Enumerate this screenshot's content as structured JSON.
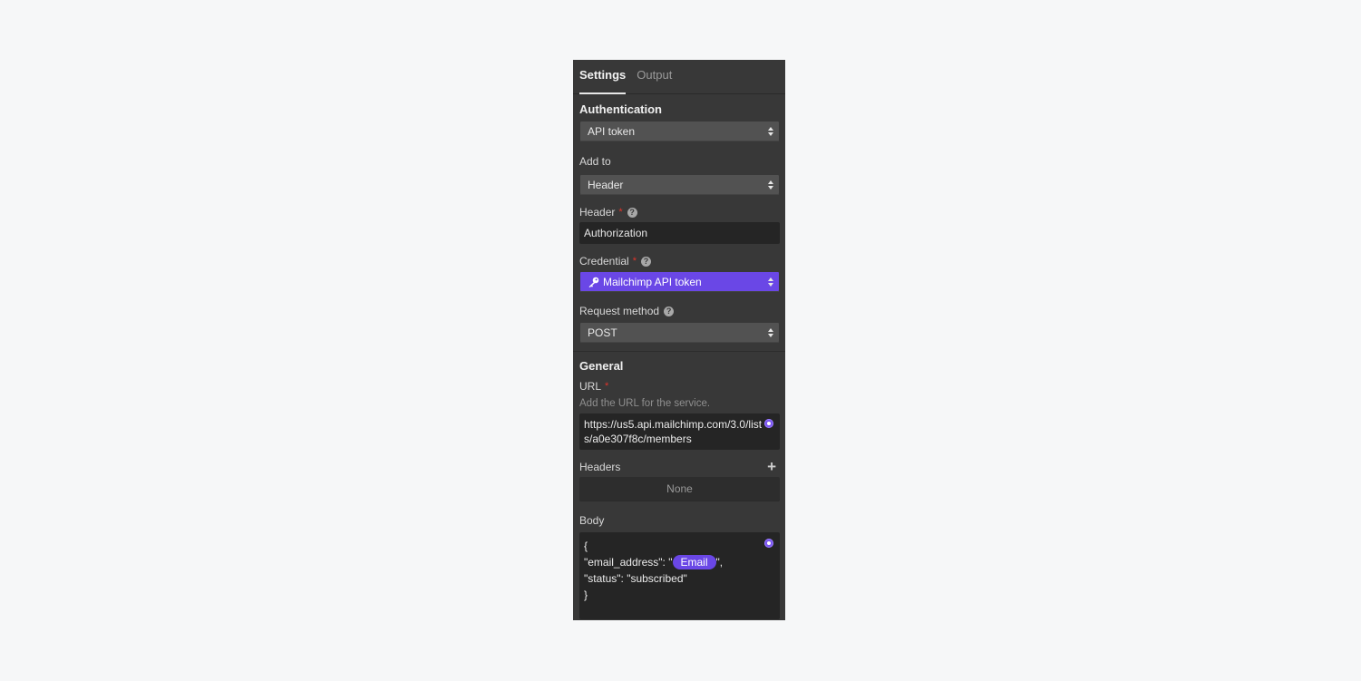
{
  "tabs": [
    {
      "label": "Settings",
      "active": true
    },
    {
      "label": "Output",
      "active": false
    }
  ],
  "authentication": {
    "title": "Authentication",
    "method": {
      "value": "API token"
    },
    "add_to": {
      "label": "Add to",
      "value": "Header"
    },
    "header": {
      "label": "Header",
      "required": "*",
      "help": "?",
      "value": "Authorization"
    },
    "credential": {
      "label": "Credential",
      "required": "*",
      "help": "?",
      "icon": "key-icon",
      "value": "Mailchimp API token",
      "color": "#6a47e6"
    },
    "request_method": {
      "label": "Request method",
      "help": "?",
      "value": "POST"
    }
  },
  "general": {
    "title": "General",
    "url": {
      "label": "URL",
      "required": "*",
      "hint": "Add the URL for the service.",
      "value": "https://us5.api.mailchimp.com/3.0/lists/a0e307f8c/members"
    },
    "headers": {
      "label": "Headers",
      "add_icon": "plus-icon",
      "empty_text": "None"
    },
    "body": {
      "label": "Body",
      "lines": {
        "open": "{",
        "email_key": "\"email_address\": \"",
        "email_pill": "Email",
        "email_end": "\",",
        "status": "\"status\": \"subscribed\"",
        "close": "}"
      }
    }
  },
  "colors": {
    "accent": "#6a47e6",
    "panel": "#383838",
    "required": "#e0342b"
  }
}
